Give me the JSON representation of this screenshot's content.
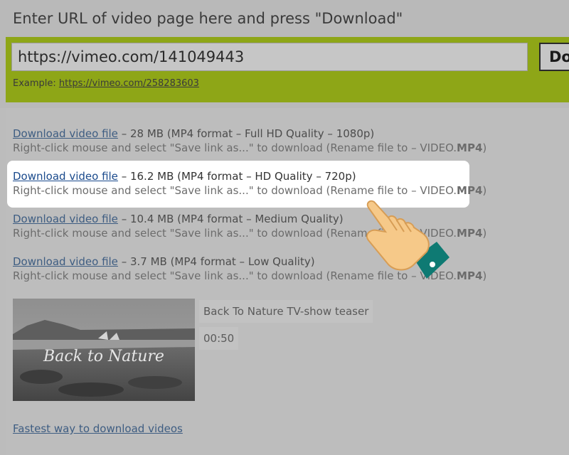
{
  "header": {
    "instruction": "Enter URL of video page here and press \"Download\""
  },
  "url_form": {
    "value": "https://vimeo.com/141049443",
    "button_label": "Download",
    "example_label": "Example:",
    "example_link": "https://vimeo.com/258283603"
  },
  "downloads": [
    {
      "link": "Download video file",
      "info": " – 28 MB (MP4 format – Full HD Quality – 1080p)",
      "hint": "Right-click mouse and select \"Save link as...\" to download (Rename file to – VIDEO.",
      "ext": "MP4"
    },
    {
      "link": "Download video file",
      "info": " – 16.2 MB (MP4 format – HD Quality – 720p)",
      "hint": "Right-click mouse and select \"Save link as...\" to download (Rename file to – VIDEO.",
      "ext": "MP4"
    },
    {
      "link": "Download video file",
      "info": " – 10.4 MB (MP4 format – Medium Quality)",
      "hint": "Right-click mouse and select \"Save link as...\" to download (Rename file to – VIDEO.",
      "ext": "MP4"
    },
    {
      "link": "Download video file",
      "info": " – 3.7 MB (MP4 format – Low Quality)",
      "hint": "Right-click mouse and select \"Save link as...\" to download (Rename file to – VIDEO.",
      "ext": "MP4"
    }
  ],
  "highlighted_index": 1,
  "video": {
    "thumbnail_text": "Back to Nature",
    "title": "Back To Nature TV-show teaser",
    "duration": "00:50"
  },
  "footer_link": "Fastest way to download videos",
  "colors": {
    "accent_green": "#8ea617",
    "link_blue": "#3e5d82",
    "highlight_bg": "#ffffff"
  },
  "icons": {
    "pointer": "pointing-hand-icon"
  }
}
